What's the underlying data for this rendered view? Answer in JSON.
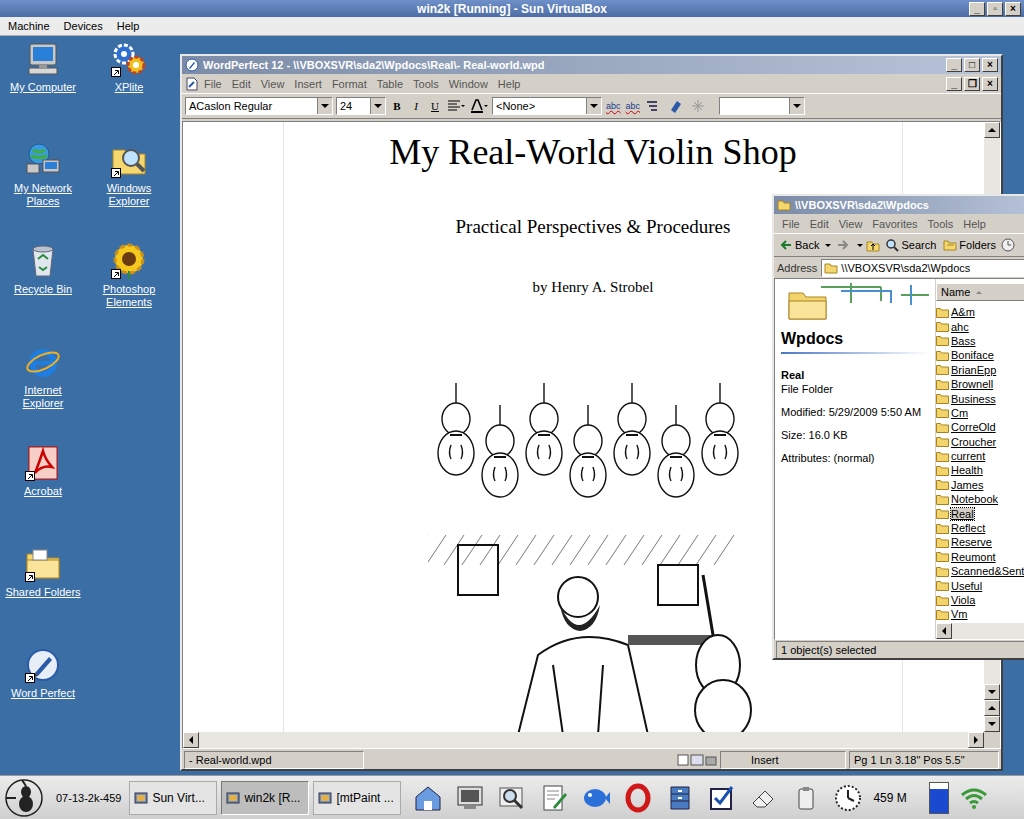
{
  "host_window": {
    "title": "win2k [Running] - Sun VirtualBox",
    "controls": [
      "_",
      "▫",
      "×"
    ]
  },
  "host_menu": [
    {
      "label": "Machine"
    },
    {
      "label": "Devices"
    },
    {
      "label": "Help"
    }
  ],
  "desktop_icons": [
    {
      "label": "My Computer",
      "kind": "computer",
      "shortcut": false
    },
    {
      "label": "My Network Places",
      "kind": "network",
      "shortcut": false
    },
    {
      "label": "Recycle Bin",
      "kind": "recycle",
      "shortcut": false
    },
    {
      "label": "Internet Explorer",
      "kind": "ie",
      "shortcut": false
    },
    {
      "label": "Acrobat",
      "kind": "acrobat",
      "shortcut": true
    },
    {
      "label": "Shared Folders",
      "kind": "folder",
      "shortcut": true
    },
    {
      "label": "Word Perfect",
      "kind": "pen",
      "shortcut": true
    },
    {
      "label": "XPlite",
      "kind": "gears",
      "shortcut": true
    },
    {
      "label": "Windows Explorer",
      "kind": "explorer",
      "shortcut": true
    },
    {
      "label": "Photoshop Elements",
      "kind": "flower",
      "shortcut": true
    }
  ],
  "wordperfect": {
    "title": "WordPerfect 12 - \\\\VBOXSVR\\sda2\\Wpdocs\\Real\\- Real-world.wpd",
    "controls": [
      "_",
      "□",
      "×"
    ],
    "doc_controls": [
      "_",
      "❐",
      "×"
    ],
    "menu": [
      "File",
      "Edit",
      "View",
      "Insert",
      "Format",
      "Table",
      "Tools",
      "Window",
      "Help"
    ],
    "toolbar": {
      "font": "ACaslon Regular",
      "size": "24",
      "styles": [
        "B",
        "I",
        "U"
      ],
      "paragraph_style": "<None>",
      "spell": [
        "abc",
        "abc"
      ]
    },
    "document": {
      "title": "My Real-World Violin Shop",
      "subtitle": "Practical Perspectives & Procedures",
      "author": "by Henry A. Strobel"
    },
    "status_bar": {
      "file": "- Real-world.wpd",
      "mode": "Insert",
      "position": "Pg 1 Ln 3.18\" Pos 5.5\""
    }
  },
  "explorer": {
    "title": "\\\\VBOXSVR\\sda2\\Wpdocs",
    "menu": [
      "File",
      "Edit",
      "View",
      "Favorites",
      "Tools",
      "Help"
    ],
    "toolbar": {
      "back": "Back",
      "search": "Search",
      "folders": "Folders"
    },
    "address_label": "Address",
    "address": "\\\\VBOXSVR\\sda2\\Wpdocs",
    "folder_heading": "Wpdocs",
    "details": {
      "name": "Real",
      "type": "File Folder",
      "modified": "Modified: 5/29/2009 5:50 AM",
      "size": "Size: 16.0 KB",
      "attributes": "Attributes: (normal)"
    },
    "column": "Name",
    "items": [
      {
        "name": "A&m",
        "selected": false
      },
      {
        "name": "ahc",
        "selected": false
      },
      {
        "name": "Bass",
        "selected": false
      },
      {
        "name": "Boniface",
        "selected": false
      },
      {
        "name": "BrianEpp",
        "selected": false
      },
      {
        "name": "Brownell",
        "selected": false
      },
      {
        "name": "Business",
        "selected": false
      },
      {
        "name": "Cm",
        "selected": false
      },
      {
        "name": "CorreOld",
        "selected": false
      },
      {
        "name": "Croucher",
        "selected": false
      },
      {
        "name": "current",
        "selected": false
      },
      {
        "name": "Health",
        "selected": false
      },
      {
        "name": "James",
        "selected": false
      },
      {
        "name": "Notebook",
        "selected": false
      },
      {
        "name": "Real",
        "selected": true
      },
      {
        "name": "Reflect",
        "selected": false
      },
      {
        "name": "Reserve",
        "selected": false
      },
      {
        "name": "Reumont",
        "selected": false
      },
      {
        "name": "Scanned&Sent",
        "selected": false
      },
      {
        "name": "Useful",
        "selected": false
      },
      {
        "name": "Viola",
        "selected": false
      },
      {
        "name": "Vm",
        "selected": false
      }
    ],
    "status": "1 object(s) selected"
  },
  "taskbar": {
    "label": "07-13-2k-459",
    "tasks": [
      {
        "label": "Sun Virt...",
        "selected": false
      },
      {
        "label": "win2k [R...",
        "selected": true
      },
      {
        "label": "[mtPaint ...",
        "selected": false
      }
    ],
    "memory": "459 M",
    "memory_level": 0.8
  }
}
